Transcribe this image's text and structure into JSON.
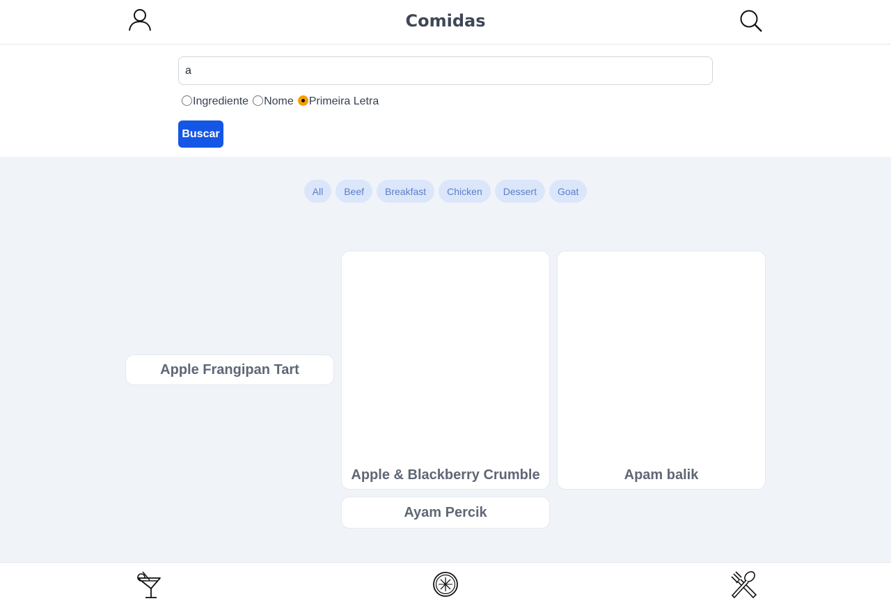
{
  "header": {
    "title": "Comidas",
    "profile_icon": "profile-icon",
    "search_icon": "search-icon"
  },
  "search": {
    "value": "a",
    "options": [
      {
        "label": "Ingrediente",
        "checked": false
      },
      {
        "label": "Nome",
        "checked": false
      },
      {
        "label": "Primeira Letra",
        "checked": true
      }
    ],
    "button_label": "Buscar"
  },
  "categories": [
    "All",
    "Beef",
    "Breakfast",
    "Chicken",
    "Dessert",
    "Goat"
  ],
  "recipes": [
    {
      "name": "Apple Frangipan Tart"
    },
    {
      "name": "Apple & Blackberry Crumble"
    },
    {
      "name": "Apam balik"
    },
    {
      "name": "Ayam Percik"
    }
  ],
  "footer": {
    "drinks_icon": "drink-icon",
    "explore_icon": "explore-icon",
    "foods_icon": "meal-icon"
  },
  "colors": {
    "accent": "#1457e6",
    "radio_checked": "#f59e0b",
    "content_bg": "#f0f4f9",
    "pill_bg": "#dbe6fb",
    "pill_text": "#5b7fc6"
  }
}
